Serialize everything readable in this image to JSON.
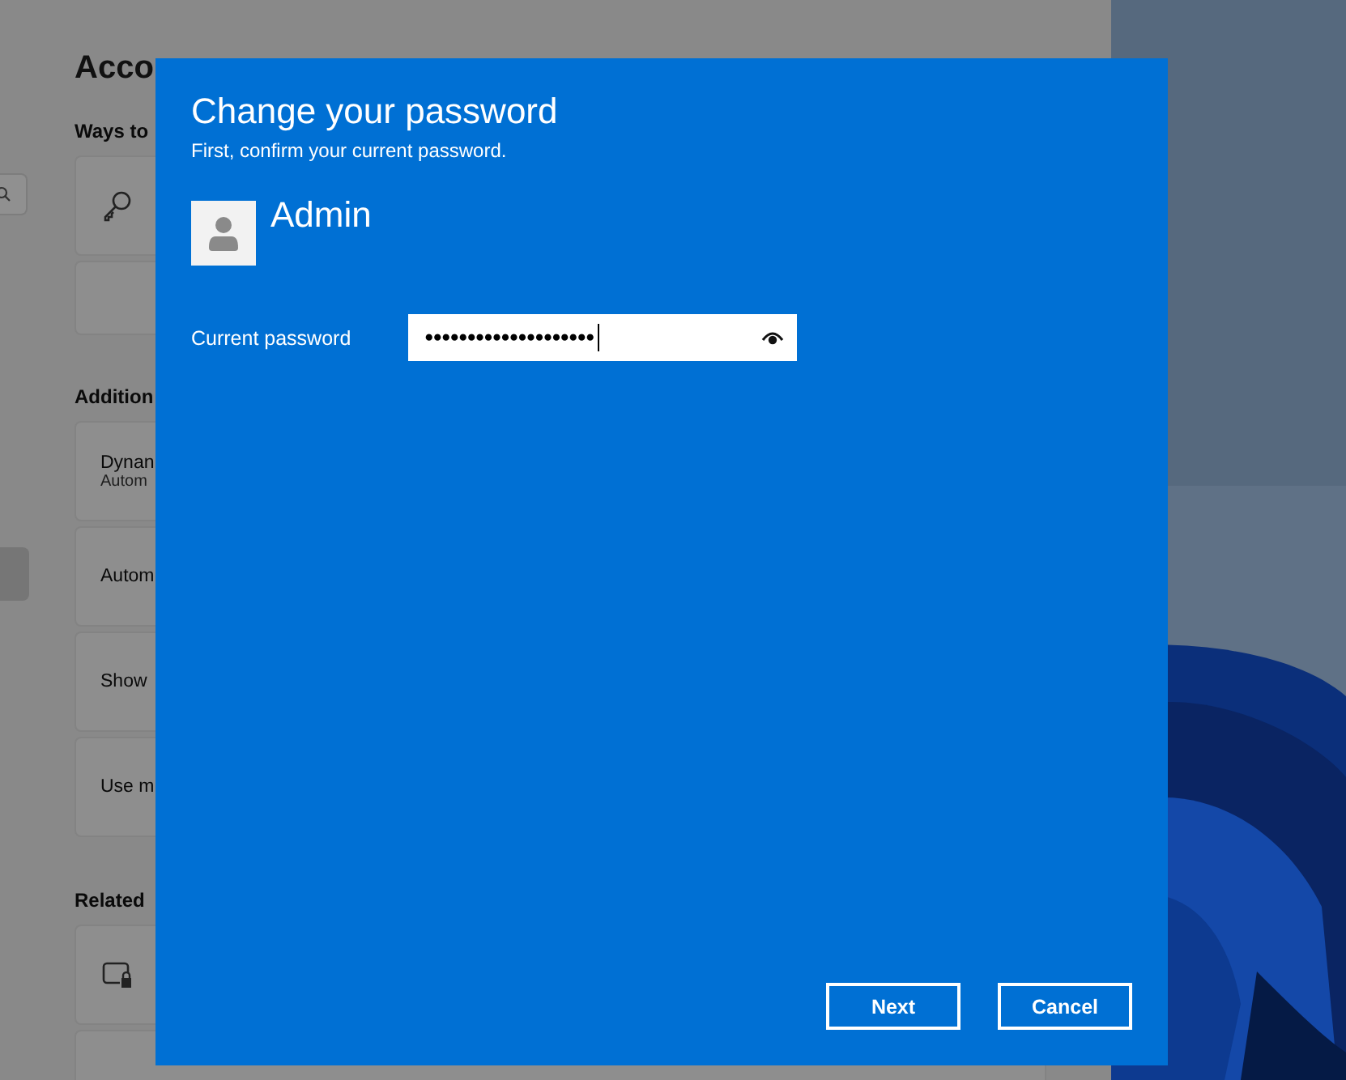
{
  "background": {
    "title": "Acco",
    "sections": [
      {
        "heading": "Ways to",
        "cards": [
          {
            "kind": "key"
          },
          {
            "kind": "blank"
          }
        ]
      },
      {
        "heading": "Addition",
        "cards": [
          {
            "kind": "text",
            "label": "Dynan",
            "sublabel": "Autom"
          },
          {
            "kind": "text",
            "label": "Autom"
          },
          {
            "kind": "text",
            "label": "Show"
          },
          {
            "kind": "text",
            "label": "Use m"
          }
        ]
      },
      {
        "heading": "Related",
        "cards": [
          {
            "kind": "lockscreen"
          },
          {
            "kind": "blank"
          }
        ]
      }
    ]
  },
  "dialog": {
    "title": "Change your password",
    "subtitle": "First, confirm your current password.",
    "user": "Admin",
    "field": {
      "label": "Current password",
      "value": "●●●●●●●●●●●●●●●●●●●●"
    },
    "buttons": [
      "Next",
      "Cancel"
    ]
  }
}
